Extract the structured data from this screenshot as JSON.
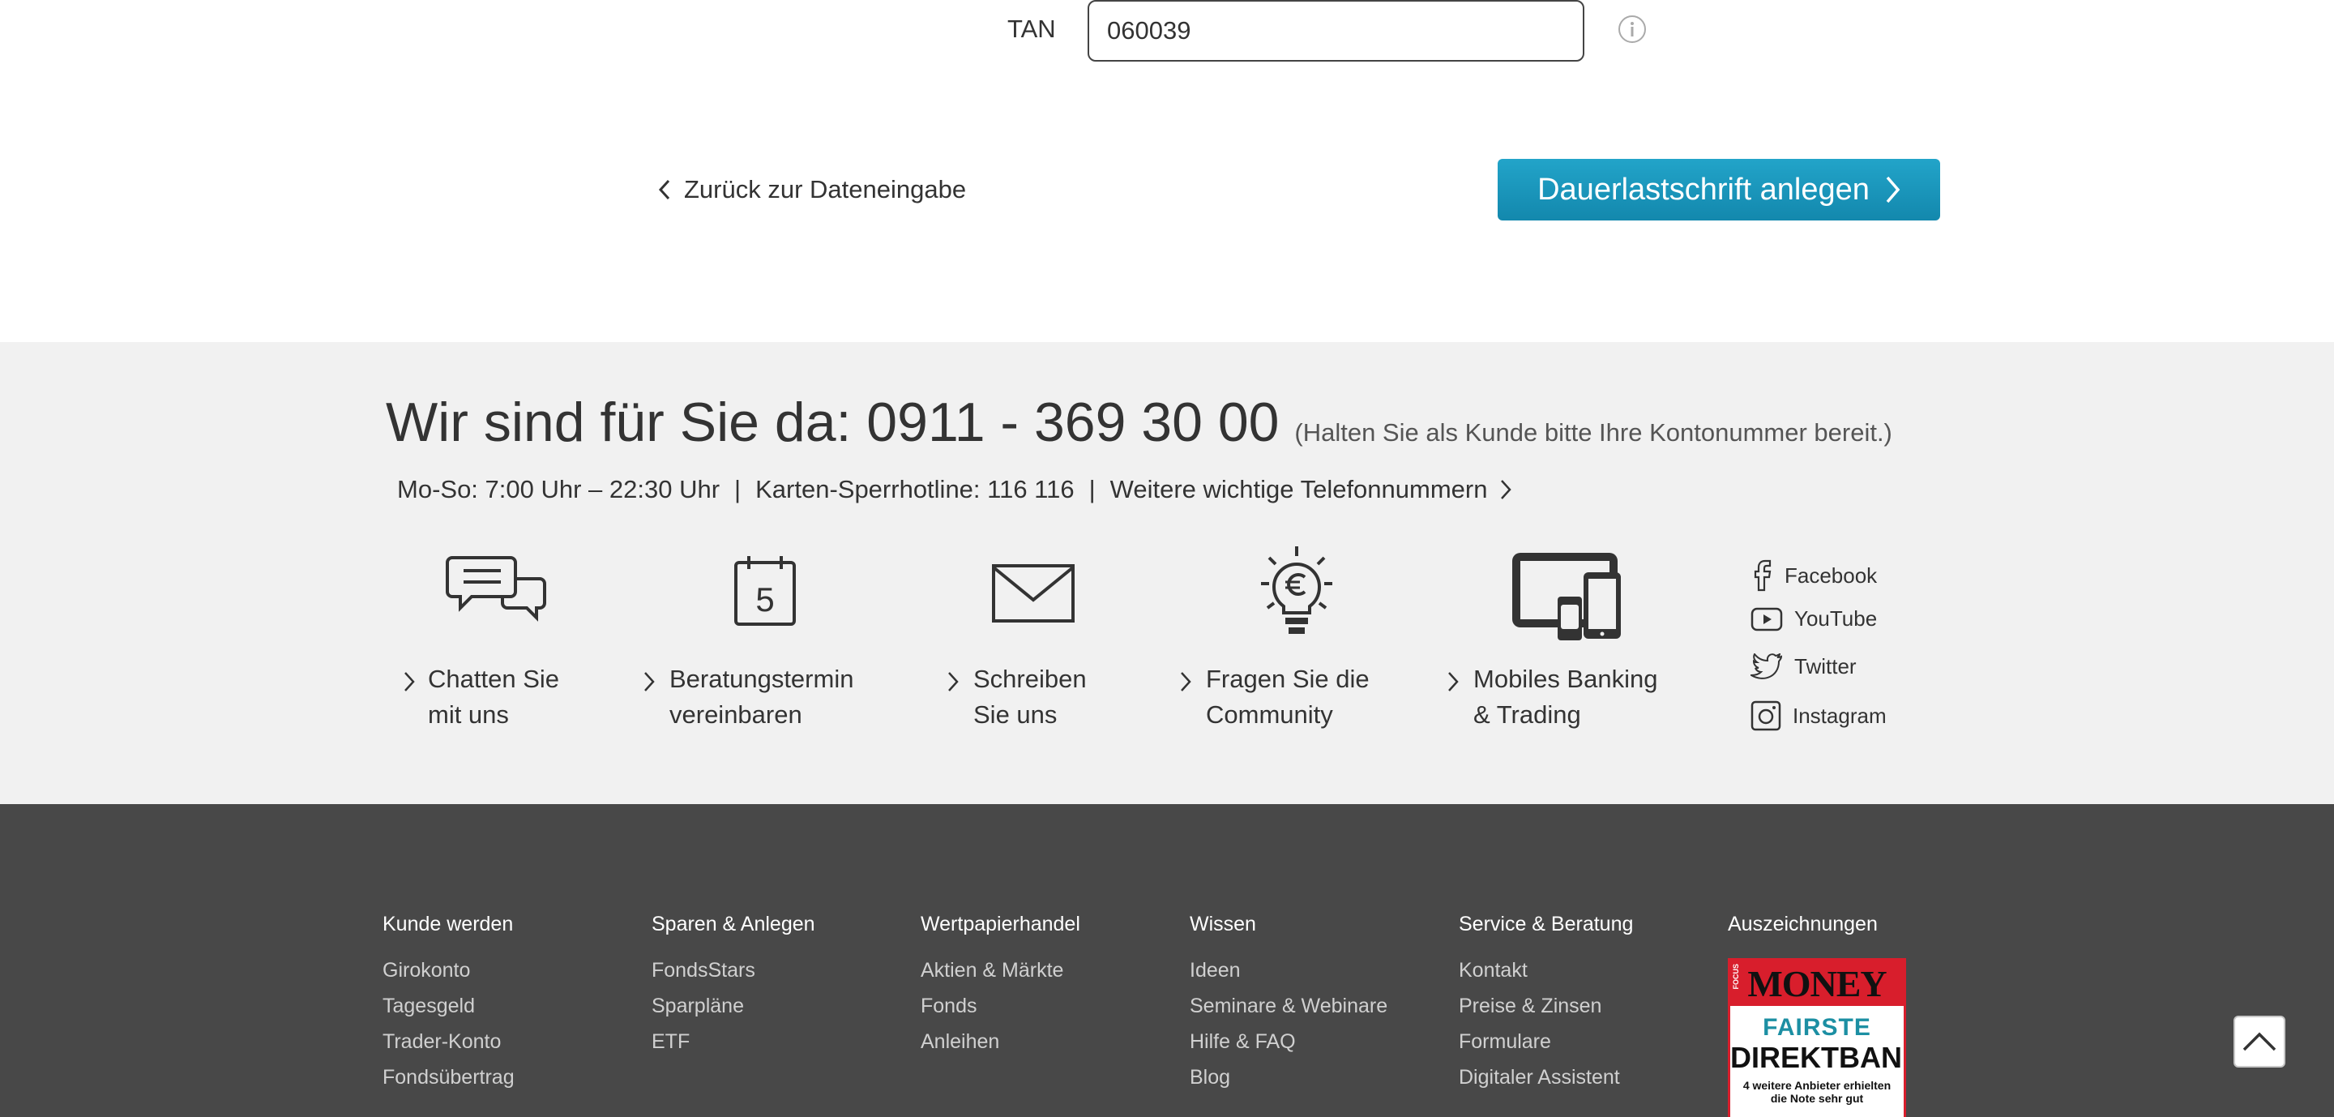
{
  "form": {
    "tan_label": "TAN",
    "tan_value": "060039",
    "back_label": "Zurück zur Dateneingabe",
    "submit_label": "Dauerlastschrift anlegen"
  },
  "contact": {
    "headline": "Wir sind für Sie da: 0911 - 369 30 00",
    "headline_note": "(Halten Sie als Kunde bitte Ihre Kontonummer bereit.)",
    "hours": "Mo-So: 7:00 Uhr – 22:30 Uhr",
    "hotline": "Karten-Sperrhotline: 116 116",
    "more_numbers": "Weitere wichtige Telefonnummern",
    "separator": "|",
    "services": [
      {
        "line1": "Chatten Sie",
        "line2": "mit uns",
        "icon": "chat-icon"
      },
      {
        "line1": "Beratungstermin",
        "line2": "vereinbaren",
        "icon": "calendar-icon",
        "calendar_day": "5"
      },
      {
        "line1": "Schreiben",
        "line2": "Sie uns",
        "icon": "envelope-icon"
      },
      {
        "line1": "Fragen Sie die",
        "line2": "Community",
        "icon": "lightbulb-euro-icon"
      },
      {
        "line1": "Mobiles Banking",
        "line2": "& Trading",
        "icon": "devices-icon"
      }
    ],
    "social": [
      {
        "label": "Facebook",
        "icon": "facebook-icon"
      },
      {
        "label": "YouTube",
        "icon": "youtube-icon"
      },
      {
        "label": "Twitter",
        "icon": "twitter-icon"
      },
      {
        "label": "Instagram",
        "icon": "instagram-icon"
      }
    ]
  },
  "footer": {
    "columns": [
      {
        "title": "Kunde werden",
        "items": [
          "Girokonto",
          "Tagesgeld",
          "Trader-Konto",
          "Fondsübertrag"
        ]
      },
      {
        "title": "Sparen & Anlegen",
        "items": [
          "FondsStars",
          "Sparpläne",
          "ETF"
        ]
      },
      {
        "title": "Wertpapierhandel",
        "items": [
          "Aktien & Märkte",
          "Fonds",
          "Anleihen"
        ]
      },
      {
        "title": "Wissen",
        "items": [
          "Ideen",
          "Seminare & Webinare",
          "Hilfe & FAQ",
          "Blog"
        ]
      },
      {
        "title": "Service & Beratung",
        "items": [
          "Kontakt",
          "Preise & Zinsen",
          "Formulare",
          "Digitaler Assistent"
        ]
      },
      {
        "title": "Auszeichnungen",
        "items": []
      }
    ],
    "award": {
      "magazine_small": "FOCUS",
      "magazine": "MONEY",
      "line1": "FAIRSTE",
      "line2": "DIREKTBANK",
      "line3": "4 weitere Anbieter erhielten",
      "line4": "die Note sehr gut"
    }
  },
  "colors": {
    "primary_button": "#1d9bc1",
    "contact_bg": "#f1f1f1",
    "footer_bg": "#484848",
    "award_red": "#d81e2c"
  }
}
